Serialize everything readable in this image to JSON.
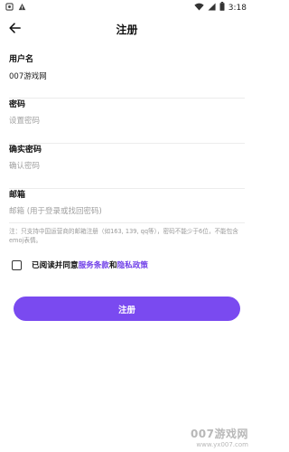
{
  "status_bar": {
    "time": "3:18",
    "left_icons": [
      "android-notification-icon",
      "warning-icon"
    ],
    "right_icons": [
      "wifi-icon",
      "cellular-signal-icon",
      "battery-icon"
    ]
  },
  "header": {
    "back_icon": "arrow-left-icon",
    "title": "注册"
  },
  "form": {
    "username": {
      "label": "用户名",
      "value": "007游戏网",
      "placeholder": ""
    },
    "password": {
      "label": "密码",
      "value": "",
      "placeholder": "设置密码"
    },
    "confirm_password": {
      "label": "确实密码",
      "value": "",
      "placeholder": "确认密码"
    },
    "email": {
      "label": "邮箱",
      "value": "",
      "placeholder": "邮箱 (用于登录或找回密码)"
    }
  },
  "note": "注：只支持中国运营商的邮箱注册（如163, 139, qq等），密码不能少于6位，不能包含emoj表情。",
  "agreement": {
    "checked": false,
    "prefix": "已阅读并同意",
    "terms_link": "服务条款",
    "conjunction": "和",
    "privacy_link": "隐私政策"
  },
  "register_button": {
    "label": "注册"
  },
  "colors": {
    "accent": "#7a4af0",
    "link": "#7040e8"
  },
  "watermark": {
    "main": "007游戏网",
    "url": "www.yx007.com"
  }
}
